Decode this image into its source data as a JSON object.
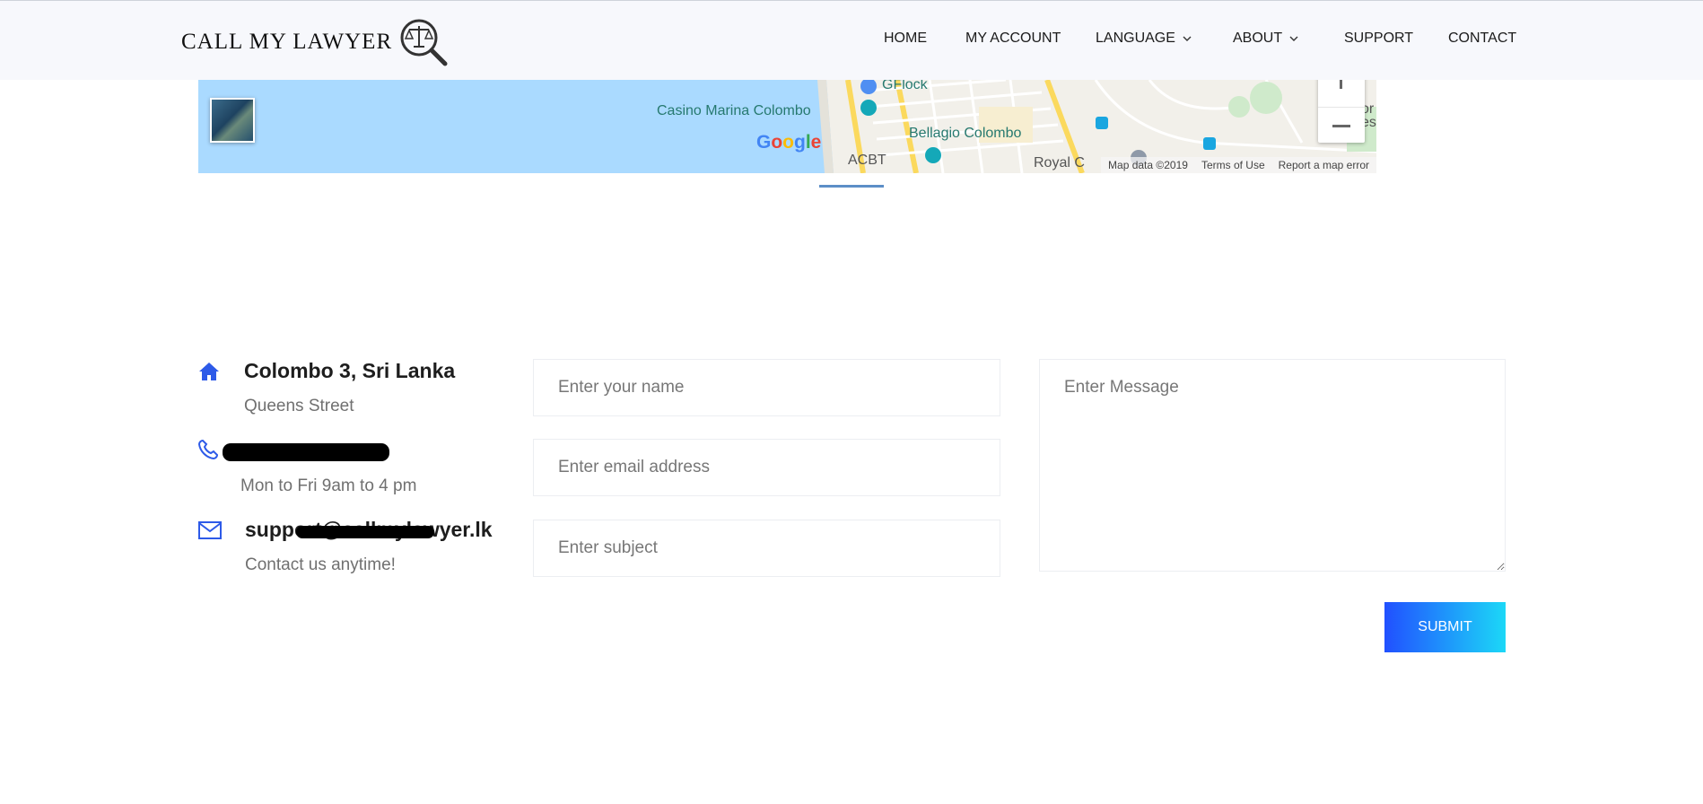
{
  "brand": {
    "logo_text": "CALL MY LAWYER",
    "logo_icon": "scales-magnifier-icon"
  },
  "nav": {
    "items": [
      {
        "label": "HOME",
        "has_dropdown": false
      },
      {
        "label": "MY ACCOUNT",
        "has_dropdown": false
      },
      {
        "label": "LANGUAGE",
        "has_dropdown": true
      },
      {
        "label": "ABOUT",
        "has_dropdown": true
      },
      {
        "label": "SUPPORT",
        "has_dropdown": false
      },
      {
        "label": "CONTACT",
        "has_dropdown": false
      }
    ]
  },
  "map": {
    "labels": {
      "gflock": "GFlock",
      "casino": "Casino Marina Colombo",
      "bellagio": "Bellagio Colombo",
      "acbt": "ACBT",
      "royal": "Royal C",
      "edge_top": "or",
      "edge_bottom": "es"
    },
    "google_logo": [
      "G",
      "o",
      "o",
      "g",
      "l",
      "e"
    ],
    "attribution": {
      "map_data": "Map data ©2019",
      "terms": "Terms of Use",
      "report": "Report a map error"
    },
    "colors": {
      "water": "#aadaff",
      "land": "#f2f0ea",
      "road": "#fbd95d"
    }
  },
  "contact_info": {
    "address": {
      "title": "Colombo 3, Sri Lanka",
      "sub": "Queens Street",
      "icon": "home-icon"
    },
    "phone": {
      "sub": "Mon to Fri 9am to 4 pm",
      "icon": "phone-icon"
    },
    "email": {
      "title": "support@callmylawyer.lk",
      "sub": "Contact us anytime!",
      "icon": "envelope-icon"
    }
  },
  "form": {
    "name_placeholder": "Enter your name",
    "email_placeholder": "Enter email address",
    "subject_placeholder": "Enter subject",
    "message_placeholder": "Enter Message",
    "submit_label": "SUBMIT"
  },
  "colors": {
    "accent": "#2150ff",
    "accent_end": "#1cd8f7",
    "header_bg": "#f7f8fc"
  }
}
